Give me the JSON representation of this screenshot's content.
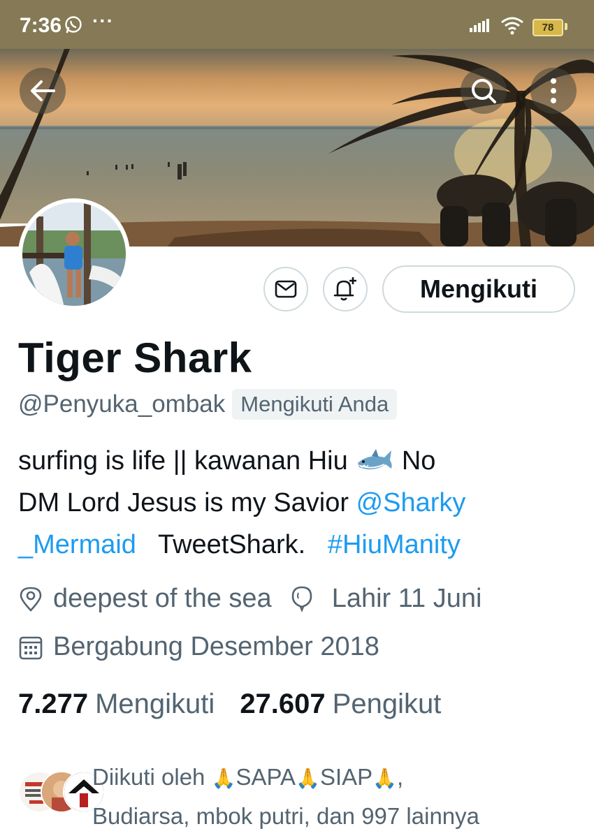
{
  "status_bar": {
    "time": "7:36",
    "extra": "···",
    "battery": "78",
    "icons": [
      "whatsapp-icon",
      "signal-icon",
      "wifi-icon",
      "battery-icon"
    ]
  },
  "colors": {
    "status_bar_bg": "#857a55",
    "link": "#1d9bf0",
    "secondary_text": "#536471",
    "primary_text": "#0f1419"
  },
  "header": {
    "icons": [
      "back-arrow-icon",
      "search-icon",
      "more-vertical-icon"
    ]
  },
  "actions": {
    "message_icon": "mail-icon",
    "notify_icon": "bell-plus-icon",
    "follow_label": "Mengikuti"
  },
  "profile": {
    "name": "Tiger Shark",
    "handle": "@Penyuka_ombak",
    "follows_you": "Mengikuti Anda",
    "bio": {
      "line1_text": "surfing is life || kawanan Hiu",
      "line1_after": "No",
      "line2_text": "DM  Lord Jesus is my Savior",
      "mention_part1": "@Sharky",
      "mention_part2": "_Mermaid",
      "line3_text": "TweetShark.",
      "hashtag": "#HiuManity"
    },
    "location": "deepest of the sea",
    "birthday": "Lahir 11 Juni",
    "joined": "Bergabung Desember 2018"
  },
  "stats": {
    "following_count": "7.277",
    "following_label": "Mengikuti",
    "followers_count": "27.607",
    "followers_label": "Pengikut"
  },
  "followed_by": {
    "prefix": "Diikuti oleh",
    "names": [
      "SAPA",
      "SIAP"
    ],
    "suffix": ",",
    "line2": "Budiarsa, mbok putri, dan 997 lainnya"
  }
}
